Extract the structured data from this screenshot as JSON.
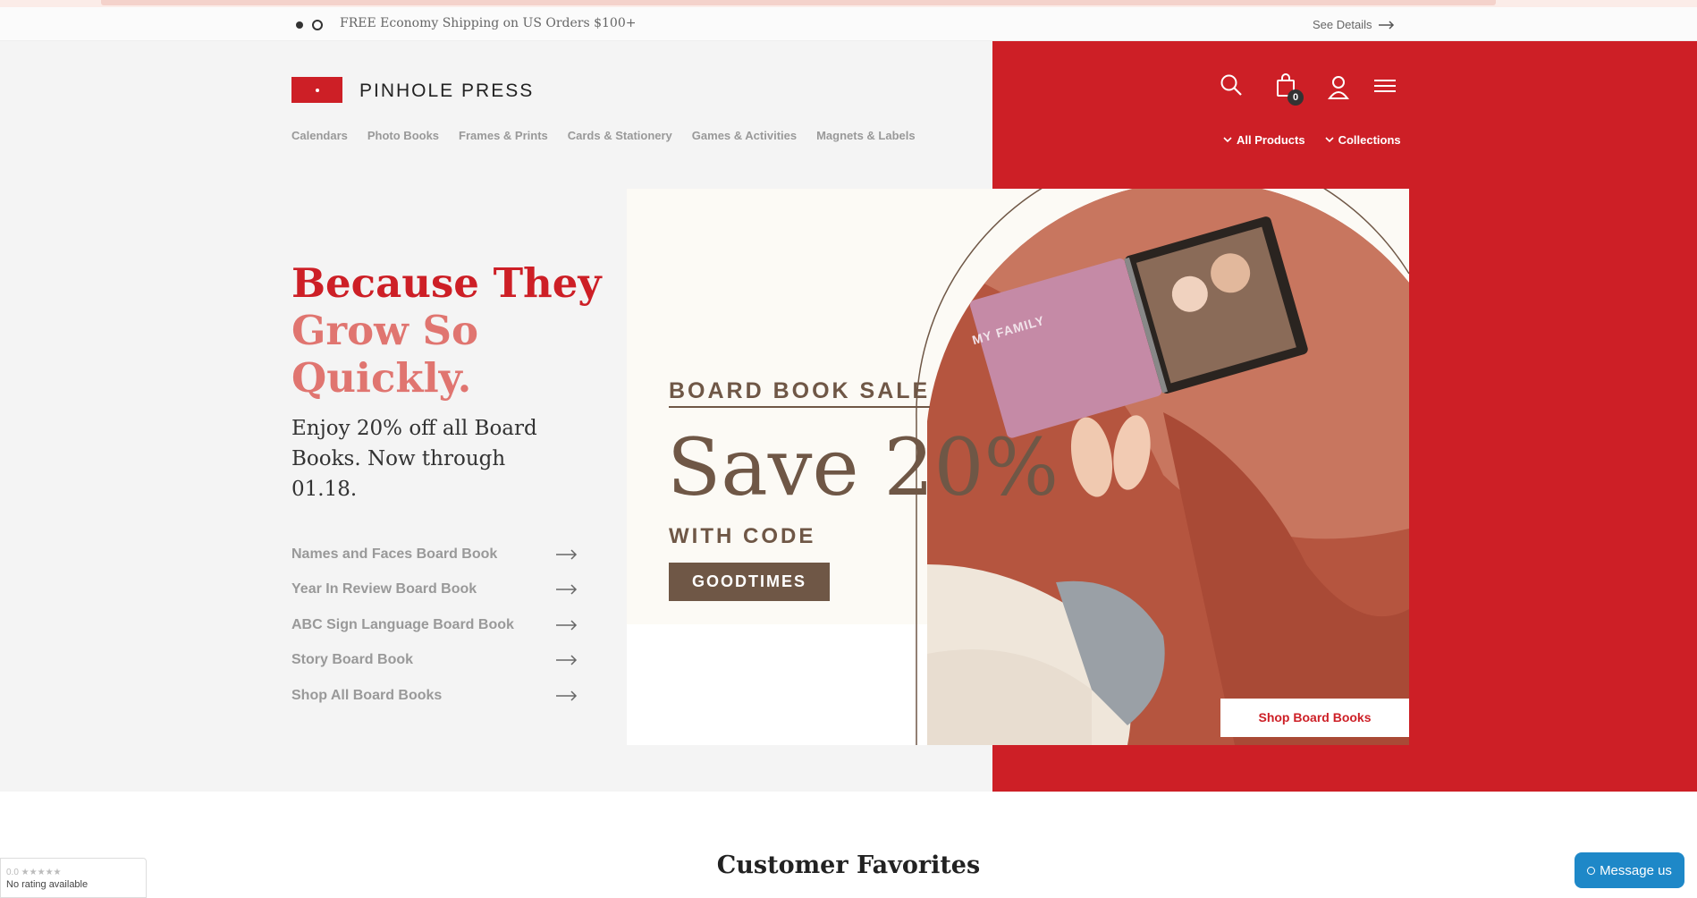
{
  "announcement": {
    "text": "FREE Economy Shipping on US Orders $100+",
    "see_details": "See Details"
  },
  "brand": {
    "name": "PINHOLE PRESS",
    "red": "#cd1f26",
    "brown": "#6f5746"
  },
  "nav": [
    "Calendars",
    "Photo Books",
    "Frames & Prints",
    "Cards & Stationery",
    "Games & Activities",
    "Magnets & Labels"
  ],
  "utility": {
    "cart_count": "0",
    "dropdowns": [
      "All Products",
      "Collections"
    ]
  },
  "hero": {
    "headline_1": "Because They",
    "headline_2": "Grow So",
    "headline_3": "Quickly.",
    "subcopy": "Enjoy 20% off all Board Books. Now through 01.18.",
    "links": [
      "Names and Faces Board Book",
      "Year In Review Board Book",
      "ABC Sign Language Board Book",
      "Story Board Book",
      "Shop All Board Books"
    ]
  },
  "promo": {
    "eyebrow": "BOARD BOOK SALE",
    "headline": "Save 20%",
    "with_code": "WITH CODE",
    "code": "GOODTIMES",
    "book_cover_text": "MY FAMILY",
    "shop_button": "Shop Board Books"
  },
  "favorites_title": "Customer Favorites",
  "rating_widget": {
    "score": "0.0 ★★★★★",
    "text": "No rating available"
  },
  "chat": {
    "label": "Message us"
  }
}
